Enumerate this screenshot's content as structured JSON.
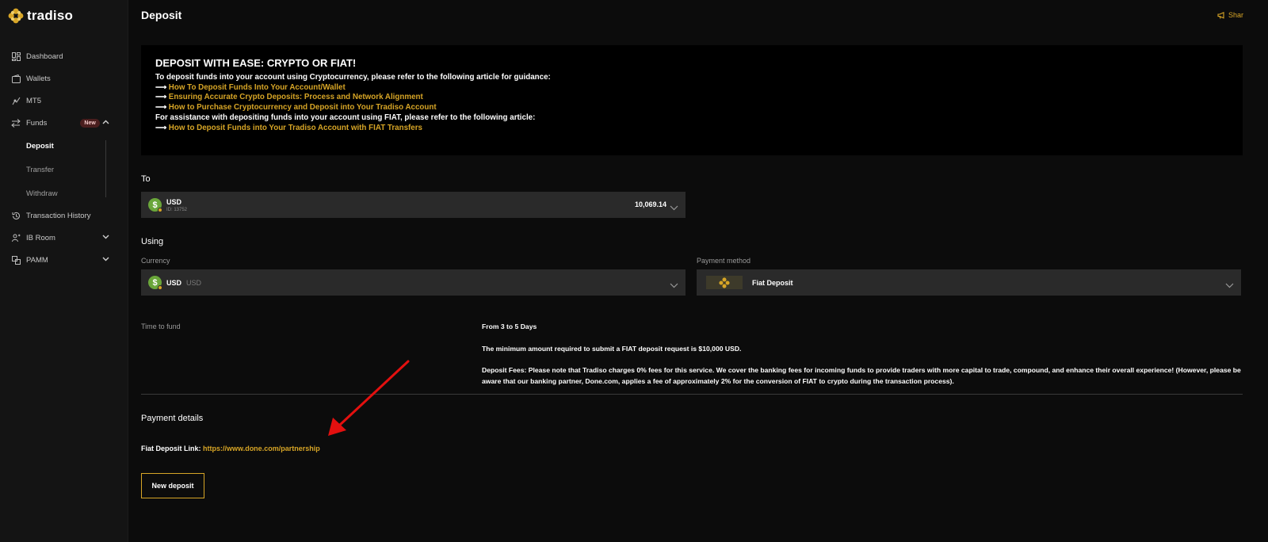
{
  "app": {
    "brand": "tradiso"
  },
  "colors": {
    "accent": "#d7a526",
    "background": "#0c0c0c",
    "sidebar": "#141414",
    "field": "#2a2a2a",
    "coin": "#6aa63a",
    "annotation_arrow": "#e3100f"
  },
  "sidebar": {
    "items": [
      {
        "label": "Dashboard",
        "icon": "dashboard-icon"
      },
      {
        "label": "Wallets",
        "icon": "wallet-icon"
      },
      {
        "label": "MT5",
        "icon": "mt5-icon"
      },
      {
        "label": "Funds",
        "icon": "transfer-arrows-icon",
        "badge": "New"
      },
      {
        "label": "Transaction History",
        "icon": "history-icon"
      },
      {
        "label": "IB Room",
        "icon": "ib-room-icon"
      },
      {
        "label": "PAMM",
        "icon": "pamm-icon"
      }
    ],
    "funds_sub": [
      {
        "label": "Deposit",
        "active": true
      },
      {
        "label": "Transfer",
        "active": false
      },
      {
        "label": "Withdraw",
        "active": false
      }
    ]
  },
  "header": {
    "title": "Deposit",
    "share_label": "Shar"
  },
  "banner": {
    "title": "DEPOSIT WITH EASE: CRYPTO OR FIAT!",
    "crypto_intro": "To deposit funds into your account using Cryptocurrency, please refer to the following article for guidance:",
    "arrow": "⟶",
    "crypto_links": [
      "How To Deposit Funds Into Your Account/Wallet",
      "Ensuring Accurate Crypto Deposits: Process and Network Alignment",
      "How to Purchase Cryptocurrency and Deposit into Your Tradiso Account"
    ],
    "fiat_intro": "For assistance with depositing funds into your account using FIAT, please refer to the following article:",
    "fiat_links": [
      "How to Deposit Funds into Your Tradiso Account with FIAT Transfers"
    ]
  },
  "to": {
    "label": "To",
    "account_name": "USD",
    "account_id": "ID: 13752",
    "balance": "10,069.14"
  },
  "using": {
    "label": "Using",
    "currency_label": "Currency",
    "currency_value": "USD",
    "currency_sub": "USD",
    "payment_label": "Payment method",
    "payment_value": "Fiat Deposit"
  },
  "info": {
    "time_label": "Time to fund",
    "time_value": "From 3 to 5 Days",
    "minimum": "The minimum amount required to submit a FIAT deposit request is $10,000 USD.",
    "fees_line1": "Deposit Fees: Please note that Tradiso charges 0% fees for this service. We cover the banking fees for incoming funds to provide traders with more capital to trade, compound, and enhance their overall experience! (However, please be",
    "fees_line2": "aware that our banking partner, Done.com, applies a fee of approximately 2% for the conversion of FIAT to crypto during the transaction process)."
  },
  "payment_details": {
    "title": "Payment details",
    "link_label": "Fiat Deposit Link:",
    "link_url": "https://www.done.com/partnership"
  },
  "actions": {
    "new_deposit": "New deposit"
  }
}
